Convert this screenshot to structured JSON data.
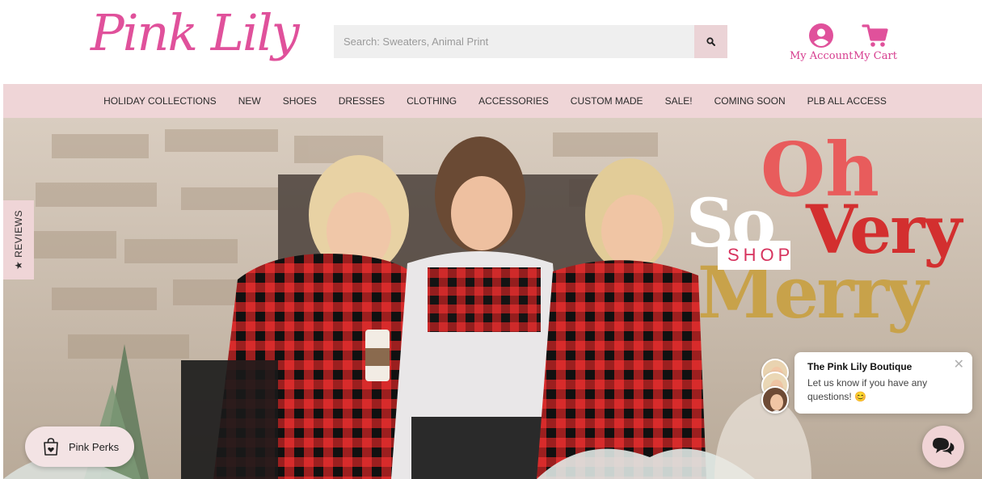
{
  "brand": {
    "logo_text": "Pink Lily",
    "accent": "#e0519b",
    "nav_bg": "#efd5d7"
  },
  "search": {
    "placeholder": "Search: Sweaters, Animal Print",
    "button_icon": "search-icon"
  },
  "account": {
    "my_account": "My Account",
    "my_cart": "My Cart",
    "account_icon": "user-circle-icon",
    "cart_icon": "cart-icon"
  },
  "nav": {
    "items": [
      {
        "label": "HOLIDAY COLLECTIONS"
      },
      {
        "label": "NEW"
      },
      {
        "label": "SHOES"
      },
      {
        "label": "DRESSES"
      },
      {
        "label": "CLOTHING"
      },
      {
        "label": "ACCESSORIES"
      },
      {
        "label": "CUSTOM MADE"
      },
      {
        "label": "SALE!"
      },
      {
        "label": "COMING SOON"
      },
      {
        "label": "PLB ALL ACCESS"
      }
    ]
  },
  "hero": {
    "headline_oh": "Oh",
    "headline_so": "So",
    "headline_very": "Very",
    "headline_merry": "Merry",
    "shop_label": "SHOP",
    "colors": {
      "oh": "#e85c5c",
      "very": "#d32f2f",
      "merry": "#c8a24a"
    }
  },
  "reviews_tab": {
    "label": "★ REVIEWS"
  },
  "perks": {
    "label": "Pink Perks",
    "icon": "shopping-bag-heart-icon"
  },
  "chat": {
    "title": "The Pink Lily Boutique",
    "message": "Let us know if you have any questions! 😊",
    "close": "✕",
    "fab_icon": "chat-bubbles-icon"
  }
}
